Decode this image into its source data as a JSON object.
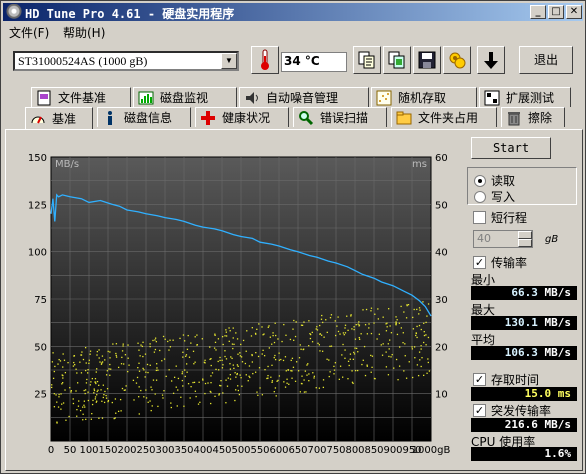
{
  "window": {
    "title": "HD Tune Pro 4.61 - 硬盘实用程序",
    "minimize": "_",
    "maximize": "□",
    "close": "✕"
  },
  "menu": {
    "file": "文件(F)",
    "help": "帮助(H)"
  },
  "toolbar": {
    "drive": "ST31000524AS (1000 gB)",
    "temperature": "34 °C",
    "exit": "退出",
    "icons": [
      "copy-text-icon",
      "copy-screenshot-icon",
      "save-icon",
      "options-icon",
      "down-arrow-icon"
    ]
  },
  "tabs_row1": [
    {
      "label": "文件基准",
      "icon": "file-benchmark-icon"
    },
    {
      "label": "磁盘监视",
      "icon": "disk-monitor-icon"
    },
    {
      "label": "自动噪音管理",
      "icon": "speaker-icon"
    },
    {
      "label": "随机存取",
      "icon": "random-access-icon"
    },
    {
      "label": "扩展测试",
      "icon": "extra-tests-icon"
    }
  ],
  "tabs_row2": [
    {
      "label": "基准",
      "icon": "benchmark-icon",
      "active": true
    },
    {
      "label": "磁盘信息",
      "icon": "info-icon"
    },
    {
      "label": "健康状况",
      "icon": "health-cross-icon"
    },
    {
      "label": "错误扫描",
      "icon": "error-scan-icon"
    },
    {
      "label": "文件夹占用",
      "icon": "folder-icon"
    },
    {
      "label": "擦除",
      "icon": "trash-icon"
    }
  ],
  "controls": {
    "start": "Start",
    "read": "读取",
    "write": "写入",
    "short_stroke": "短行程",
    "short_stroke_value": "40",
    "short_stroke_unit": "gB",
    "transfer_rate": "传输率",
    "access_time": "存取时间",
    "burst_rate": "突发传输率",
    "cpu_usage": "CPU 使用率"
  },
  "stats": {
    "min_label": "最小",
    "min_value": "66.3",
    "min_unit": "MB/s",
    "max_label": "最大",
    "max_value": "130.1",
    "max_unit": "MB/s",
    "avg_label": "平均",
    "avg_value": "106.3",
    "avg_unit": "MB/s",
    "access_value": "15.0",
    "access_unit": "ms",
    "burst_value": "216.6",
    "burst_unit": "MB/s",
    "cpu_value": "1.6%"
  },
  "colors": {
    "transfer_line": "#30b0ff",
    "access_dots": "#e8e830",
    "chart_top": "#5a5a5a",
    "chart_bottom": "#000000"
  },
  "chart_data": {
    "type": "line",
    "xlabel": "gB",
    "ylabel_left": "MB/s",
    "ylabel_right": "ms",
    "xlim": [
      0,
      1000
    ],
    "ylim_left": [
      0,
      150
    ],
    "ylim_right": [
      0,
      60
    ],
    "x_ticks": [
      0,
      50,
      100,
      150,
      200,
      250,
      300,
      350,
      400,
      450,
      500,
      550,
      600,
      650,
      700,
      750,
      800,
      850,
      900,
      950,
      1000
    ],
    "y_ticks_left": [
      25,
      50,
      75,
      100,
      125,
      150
    ],
    "y_ticks_right": [
      10,
      20,
      30,
      40,
      50,
      60
    ],
    "grid": true,
    "series": [
      {
        "name": "传输率",
        "x": [
          0,
          5,
          10,
          15,
          20,
          30,
          50,
          80,
          100,
          130,
          160,
          180,
          200,
          230,
          250,
          280,
          300,
          330,
          350,
          380,
          400,
          430,
          450,
          480,
          500,
          530,
          550,
          580,
          600,
          630,
          650,
          680,
          700,
          730,
          750,
          780,
          800,
          820,
          850,
          870,
          900,
          930,
          950,
          970,
          985,
          1000
        ],
        "values": [
          120,
          128,
          116,
          130,
          129,
          130,
          129,
          128,
          126,
          127,
          125,
          124,
          122,
          121,
          120,
          119,
          118,
          117,
          116,
          114,
          113,
          112,
          111,
          109,
          108,
          107,
          105,
          104,
          103,
          101,
          100,
          98,
          97,
          95,
          94,
          92,
          90,
          88,
          86,
          84,
          82,
          79,
          77,
          74,
          71,
          66
        ]
      },
      {
        "name": "存取时间",
        "type": "scatter",
        "axis": "right",
        "x_range": [
          0,
          1000
        ],
        "values_ms_range_start": [
          3,
          19
        ],
        "values_ms_range_end": [
          14,
          30
        ]
      }
    ]
  }
}
